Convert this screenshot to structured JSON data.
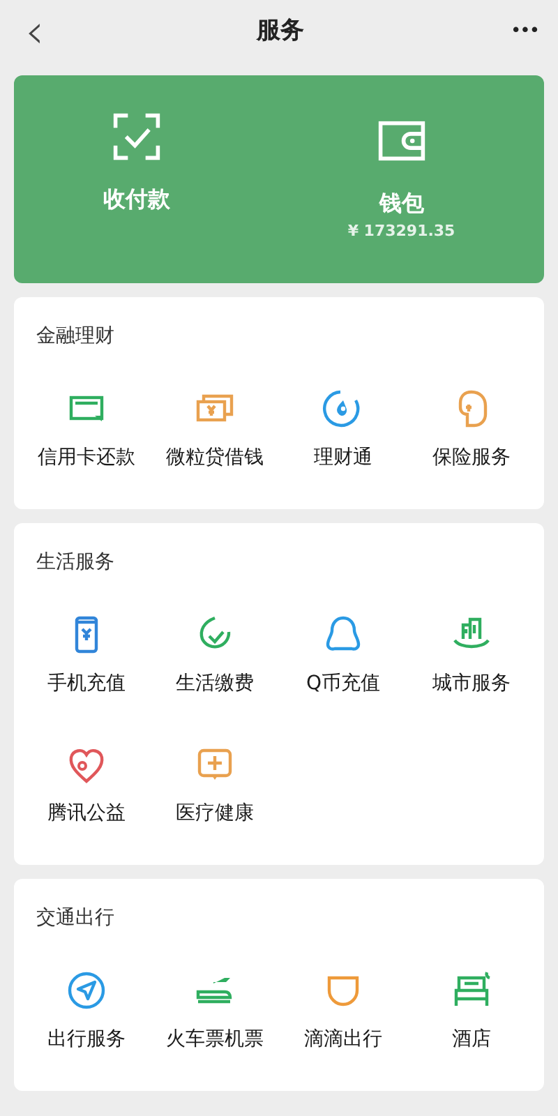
{
  "header": {
    "back": "‹",
    "title": "服务",
    "more": "•••"
  },
  "wallet_card": {
    "items": [
      {
        "label": "收付款"
      },
      {
        "label": "钱包",
        "sub": "¥ 173291.35"
      }
    ]
  },
  "sections": [
    {
      "title": "金融理财",
      "items": [
        {
          "label": "信用卡还款",
          "color": "#2fae5f"
        },
        {
          "label": "微粒贷借钱",
          "color": "#e9a14f"
        },
        {
          "label": "理财通",
          "color": "#2a9ae4"
        },
        {
          "label": "保险服务",
          "color": "#e9a14f"
        }
      ]
    },
    {
      "title": "生活服务",
      "items": [
        {
          "label": "手机充值",
          "color": "#3185d9"
        },
        {
          "label": "生活缴费",
          "color": "#2fae5f"
        },
        {
          "label": "Q币充值",
          "color": "#2a9ae4"
        },
        {
          "label": "城市服务",
          "color": "#2fae5f"
        },
        {
          "label": "腾讯公益",
          "color": "#e0575a"
        },
        {
          "label": "医疗健康",
          "color": "#e9a14f"
        }
      ]
    },
    {
      "title": "交通出行",
      "items": [
        {
          "label": "出行服务",
          "color": "#2a9ae4"
        },
        {
          "label": "火车票机票",
          "color": "#2fae5f"
        },
        {
          "label": "滴滴出行",
          "color": "#ee9a3a"
        },
        {
          "label": "酒店",
          "color": "#2fae5f"
        }
      ]
    }
  ]
}
